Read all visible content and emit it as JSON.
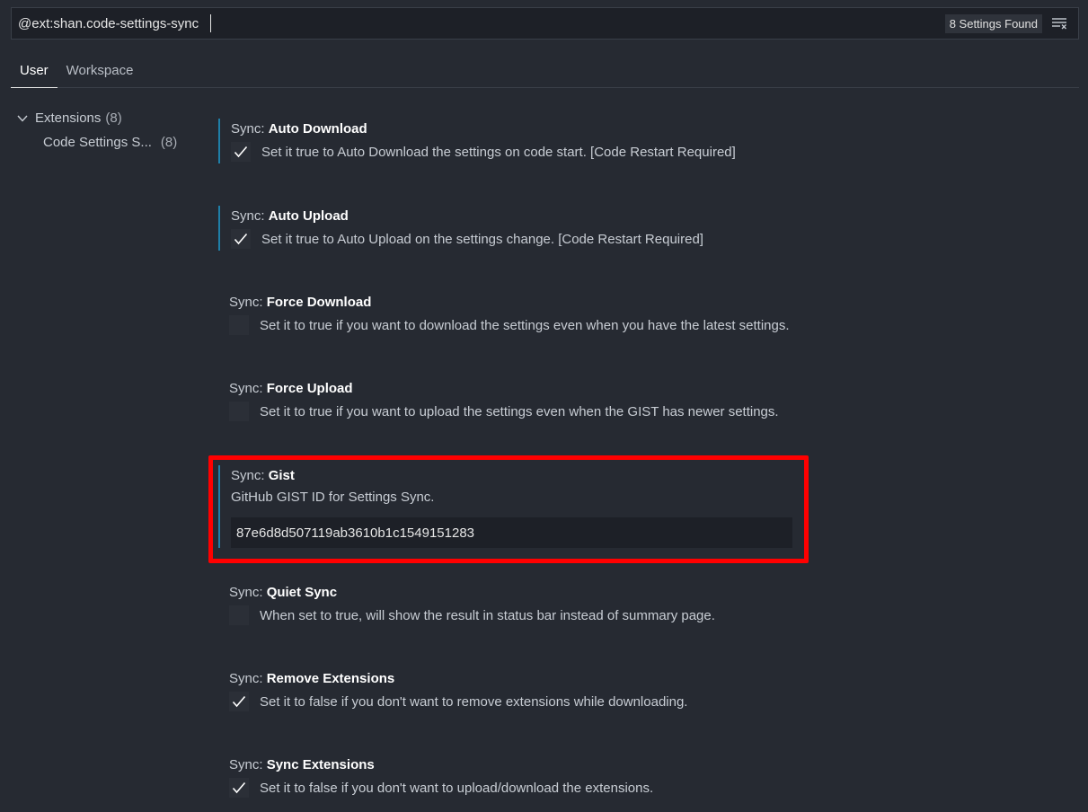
{
  "search": {
    "value": "@ext:shan.code-settings-sync",
    "found_label": "8 Settings Found"
  },
  "tabs": [
    {
      "label": "User"
    },
    {
      "label": "Workspace"
    }
  ],
  "toc": {
    "group": {
      "label": "Extensions",
      "count": "(8)"
    },
    "child": {
      "label": "Code Settings S...",
      "count": "(8)"
    }
  },
  "settings": [
    {
      "category": "Sync: ",
      "name": "Auto Download",
      "desc": "Set it true to Auto Download the settings on code start. [Code Restart Required]",
      "checked": true
    },
    {
      "category": "Sync: ",
      "name": "Auto Upload",
      "desc": "Set it true to Auto Upload on the settings change. [Code Restart Required]",
      "checked": true
    },
    {
      "category": "Sync: ",
      "name": "Force Download",
      "desc": "Set it to true if you want to download the settings even when you have the latest settings.",
      "checked": false
    },
    {
      "category": "Sync: ",
      "name": "Force Upload",
      "desc": "Set it to true if you want to upload the settings even when the GIST has newer settings.",
      "checked": false
    },
    {
      "category": "Sync: ",
      "name": "Gist",
      "desc": "GitHub GIST ID for Settings Sync.",
      "value": "87e6d8d507119ab3610b1c1549151283"
    },
    {
      "category": "Sync: ",
      "name": "Quiet Sync",
      "desc": "When set to true, will show the result in status bar instead of summary page.",
      "checked": false
    },
    {
      "category": "Sync: ",
      "name": "Remove Extensions",
      "desc": "Set it to false if you don't want to remove extensions while downloading.",
      "checked": true
    },
    {
      "category": "Sync: ",
      "name": "Sync Extensions",
      "desc": "Set it to false if you don't want to upload/download the extensions.",
      "checked": true
    }
  ],
  "colors": {
    "modified_indicator": "#1f7fa8",
    "highlight": "#ff0000"
  }
}
